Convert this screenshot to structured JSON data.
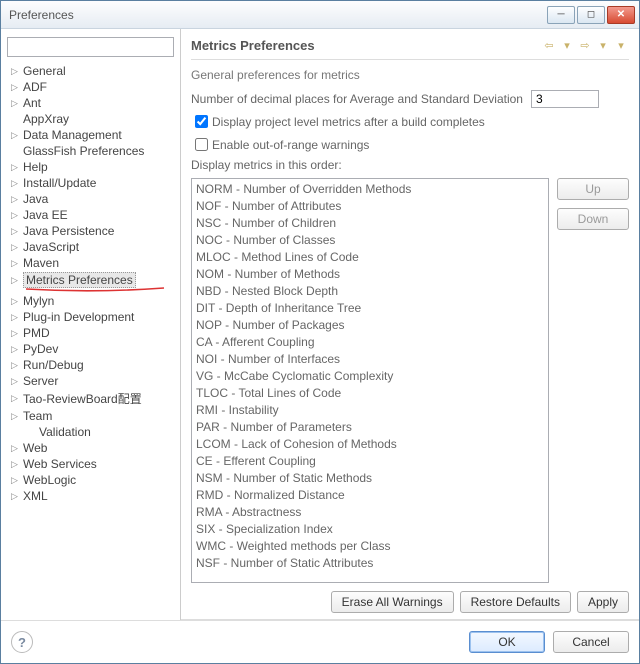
{
  "window": {
    "title": "Preferences"
  },
  "left": {
    "filter_placeholder": "",
    "items": [
      {
        "label": "General",
        "expandable": true
      },
      {
        "label": "ADF",
        "expandable": true
      },
      {
        "label": "Ant",
        "expandable": true
      },
      {
        "label": "AppXray",
        "expandable": false
      },
      {
        "label": "Data Management",
        "expandable": true
      },
      {
        "label": "GlassFish Preferences",
        "expandable": false
      },
      {
        "label": "Help",
        "expandable": true
      },
      {
        "label": "Install/Update",
        "expandable": true
      },
      {
        "label": "Java",
        "expandable": true
      },
      {
        "label": "Java EE",
        "expandable": true
      },
      {
        "label": "Java Persistence",
        "expandable": true
      },
      {
        "label": "JavaScript",
        "expandable": true
      },
      {
        "label": "Maven",
        "expandable": true
      },
      {
        "label": "Metrics Preferences",
        "expandable": true,
        "selected": true,
        "underline": true
      },
      {
        "label": "Mylyn",
        "expandable": true
      },
      {
        "label": "Plug-in Development",
        "expandable": true
      },
      {
        "label": "PMD",
        "expandable": true
      },
      {
        "label": "PyDev",
        "expandable": true
      },
      {
        "label": "Run/Debug",
        "expandable": true
      },
      {
        "label": "Server",
        "expandable": true
      },
      {
        "label": "Tao-ReviewBoard配置",
        "expandable": true
      },
      {
        "label": "Team",
        "expandable": true
      },
      {
        "label": "Validation",
        "expandable": false,
        "child": true
      },
      {
        "label": "Web",
        "expandable": true
      },
      {
        "label": "Web Services",
        "expandable": true
      },
      {
        "label": "WebLogic",
        "expandable": true
      },
      {
        "label": "XML",
        "expandable": true
      }
    ]
  },
  "right": {
    "heading": "Metrics Preferences",
    "description": "General preferences for metrics",
    "decimal_label": "Number of decimal places for Average and Standard Deviation",
    "decimal_value": "3",
    "display_project_label": "Display project level metrics after a build completes",
    "display_project_checked": true,
    "enable_warnings_label": "Enable out-of-range warnings",
    "enable_warnings_checked": false,
    "order_label": "Display metrics in this order:",
    "metrics": [
      "NORM - Number of Overridden Methods",
      "NOF - Number of Attributes",
      "NSC - Number of Children",
      "NOC - Number of Classes",
      "MLOC - Method Lines of Code",
      "NOM - Number of Methods",
      "NBD - Nested Block Depth",
      "DIT - Depth of Inheritance Tree",
      "NOP - Number of Packages",
      "CA - Afferent Coupling",
      "NOI - Number of Interfaces",
      "VG - McCabe Cyclomatic Complexity",
      "TLOC - Total Lines of Code",
      "RMI - Instability",
      "PAR - Number of Parameters",
      "LCOM - Lack of Cohesion of Methods",
      "CE - Efferent Coupling",
      "NSM - Number of Static Methods",
      "RMD - Normalized Distance",
      "RMA - Abstractness",
      "SIX - Specialization Index",
      "WMC - Weighted methods per Class",
      "NSF - Number of Static Attributes"
    ],
    "up_label": "Up",
    "down_label": "Down",
    "erase_label": "Erase All Warnings",
    "restore_label": "Restore Defaults",
    "apply_label": "Apply"
  },
  "footer": {
    "ok_label": "OK",
    "cancel_label": "Cancel"
  }
}
